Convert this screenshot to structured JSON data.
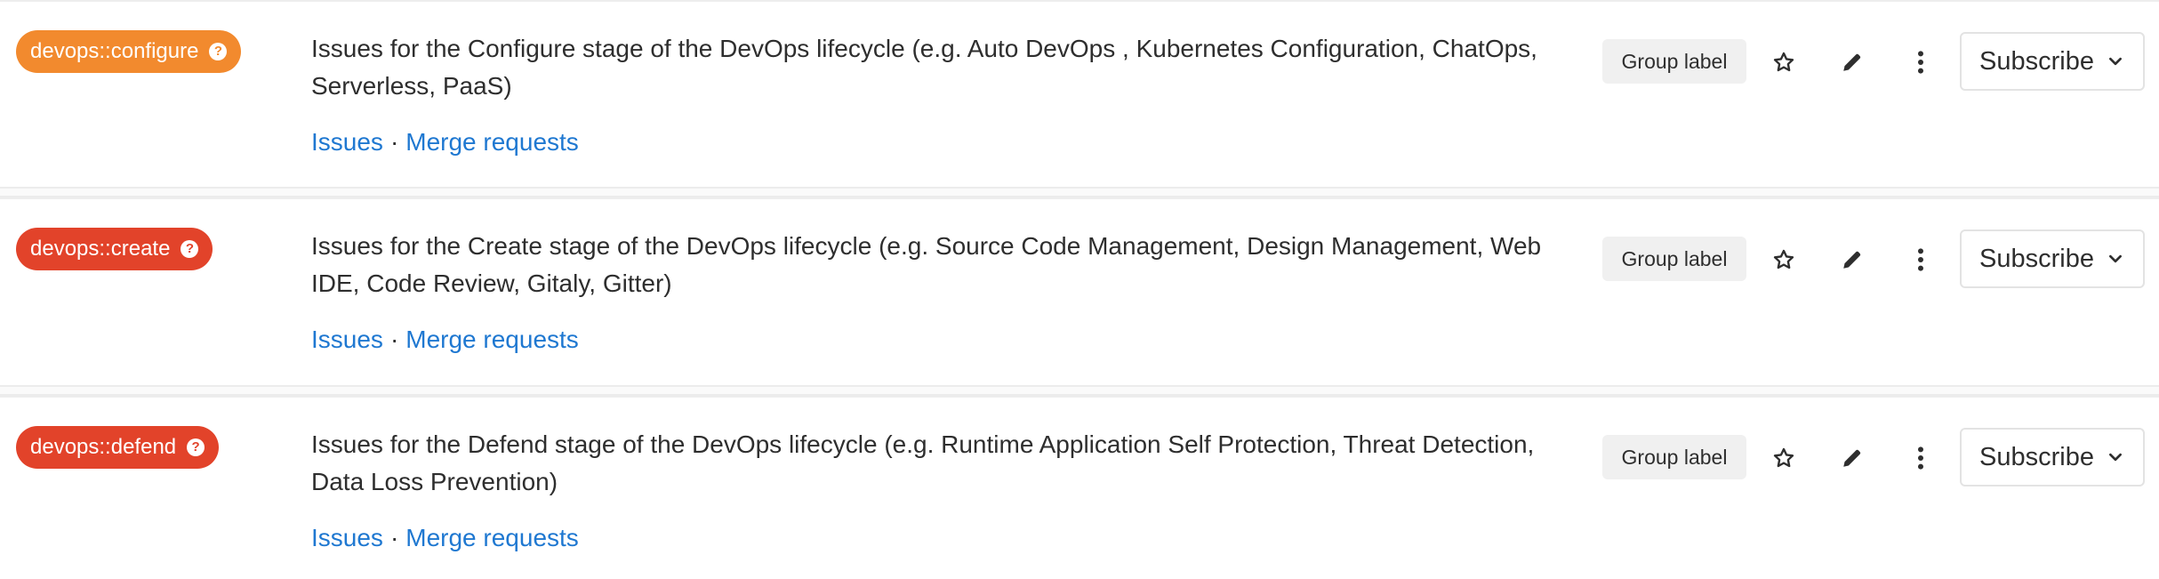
{
  "labels": [
    {
      "name": "devops::configure",
      "color": "#f28a2e",
      "description": "Issues for the Configure stage of the DevOps lifecycle (e.g. Auto DevOps , Kubernetes Configuration, ChatOps, Serverless, PaaS)",
      "issues_link": "Issues",
      "separator": "·",
      "mr_link": "Merge requests",
      "scope": "Group label",
      "subscribe_label": "Subscribe"
    },
    {
      "name": "devops::create",
      "color": "#e2432a",
      "description": "Issues for the Create stage of the DevOps lifecycle (e.g. Source Code Management, Design Management, Web IDE, Code Review, Gitaly, Gitter)",
      "issues_link": "Issues",
      "separator": "·",
      "mr_link": "Merge requests",
      "scope": "Group label",
      "subscribe_label": "Subscribe"
    },
    {
      "name": "devops::defend",
      "color": "#e2432a",
      "description": "Issues for the Defend stage of the DevOps lifecycle (e.g. Runtime Application Self Protection, Threat Detection, Data Loss Prevention)",
      "issues_link": "Issues",
      "separator": "·",
      "mr_link": "Merge requests",
      "scope": "Group label",
      "subscribe_label": "Subscribe"
    }
  ],
  "colors": {
    "link": "#1f78d1",
    "text": "#2e2e2e",
    "chip_bg": "#f0f0f0",
    "border": "#e3e3e3"
  },
  "icons": {
    "badge_help": "question-circle-icon",
    "star": "star-icon",
    "edit": "pencil-icon",
    "more": "ellipsis-v-icon",
    "dropdown": "chevron-down-icon"
  }
}
